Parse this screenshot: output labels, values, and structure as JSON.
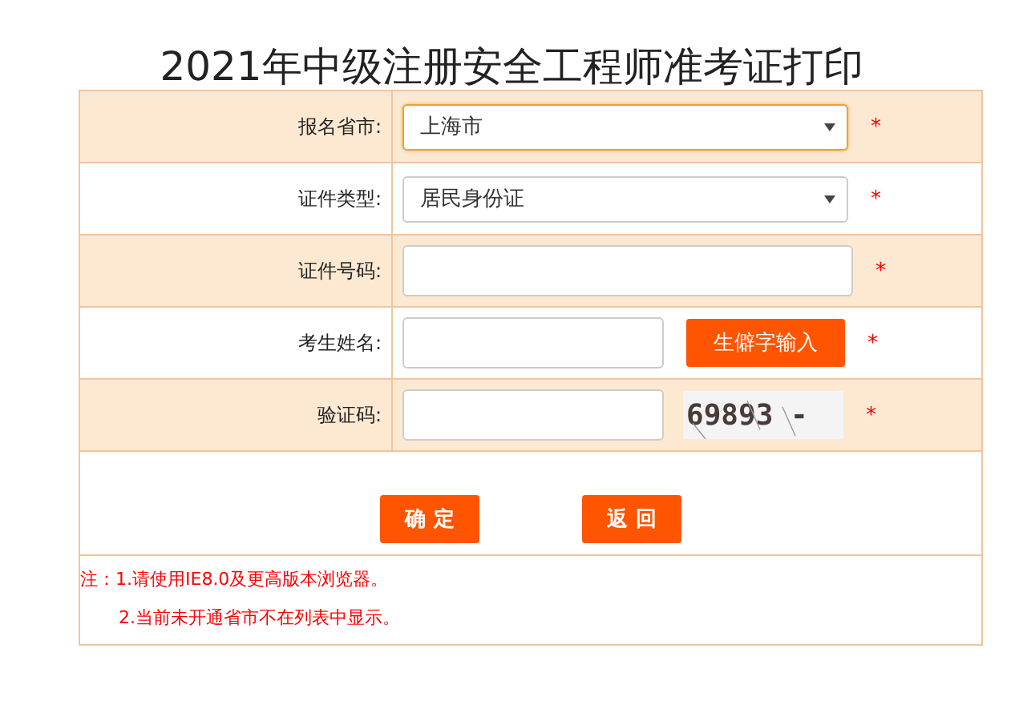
{
  "title": "2021年中级注册安全工程师准考证打印",
  "rows": [
    {
      "label": "报名省市:",
      "kind": "select",
      "value": "上海市",
      "focused": true,
      "required": "*"
    },
    {
      "label": "证件类型:",
      "kind": "select",
      "value": "居民身份证",
      "focused": false,
      "required": "*"
    },
    {
      "label": "证件号码:",
      "kind": "input",
      "required": "*"
    },
    {
      "label": "考生姓名:",
      "kind": "input_button",
      "button": "生僻字输入",
      "required": "*"
    },
    {
      "label": "验证码:",
      "kind": "captcha",
      "captcha": "69893 -",
      "required": "*"
    }
  ],
  "buttons": [
    "确 定",
    "返 回"
  ],
  "notes": [
    "注：1.请使用IE8.0及更高版本浏览器。",
    "2.当前未开通省市不在列表中显示。"
  ]
}
